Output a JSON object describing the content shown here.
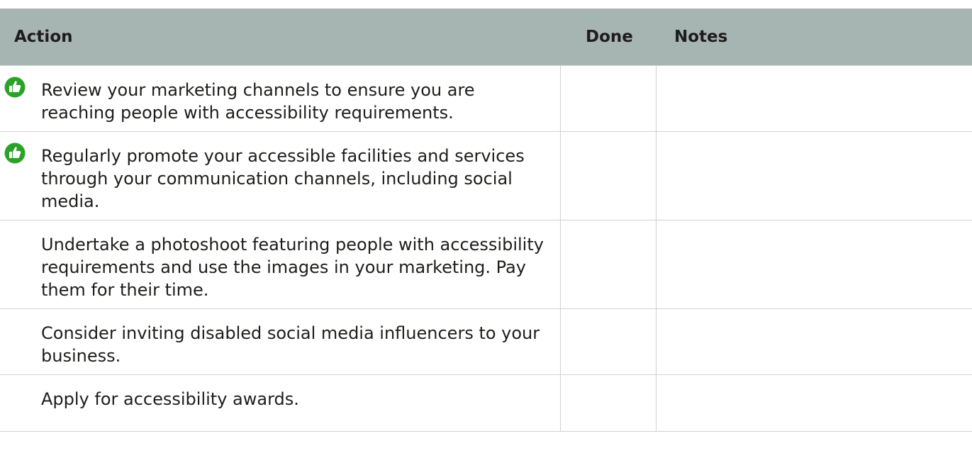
{
  "table": {
    "headers": {
      "action": "Action",
      "done": "Done",
      "notes": "Notes"
    },
    "rows": [
      {
        "recommended": true,
        "icon": "thumbs-up-icon",
        "action": "Review your marketing channels to ensure you are reaching people with accessibility requirements.",
        "done": "",
        "notes": ""
      },
      {
        "recommended": true,
        "icon": "thumbs-up-icon",
        "action": "Regularly promote your accessible facilities and services through your communication channels, including social media.",
        "done": "",
        "notes": ""
      },
      {
        "recommended": false,
        "action": "Undertake a photoshoot featuring people with accessibility requirements and use the images in your marketing. Pay them for their time.",
        "done": "",
        "notes": ""
      },
      {
        "recommended": false,
        "action": "Consider inviting disabled social media influencers to your business.",
        "done": "",
        "notes": ""
      },
      {
        "recommended": false,
        "action": "Apply for accessibility awards.",
        "done": "",
        "notes": ""
      }
    ]
  },
  "colors": {
    "header_background": "#a7b5b2",
    "icon_green": "#2aa22a",
    "border": "#cfd4d2",
    "text": "#1d1d1b"
  }
}
